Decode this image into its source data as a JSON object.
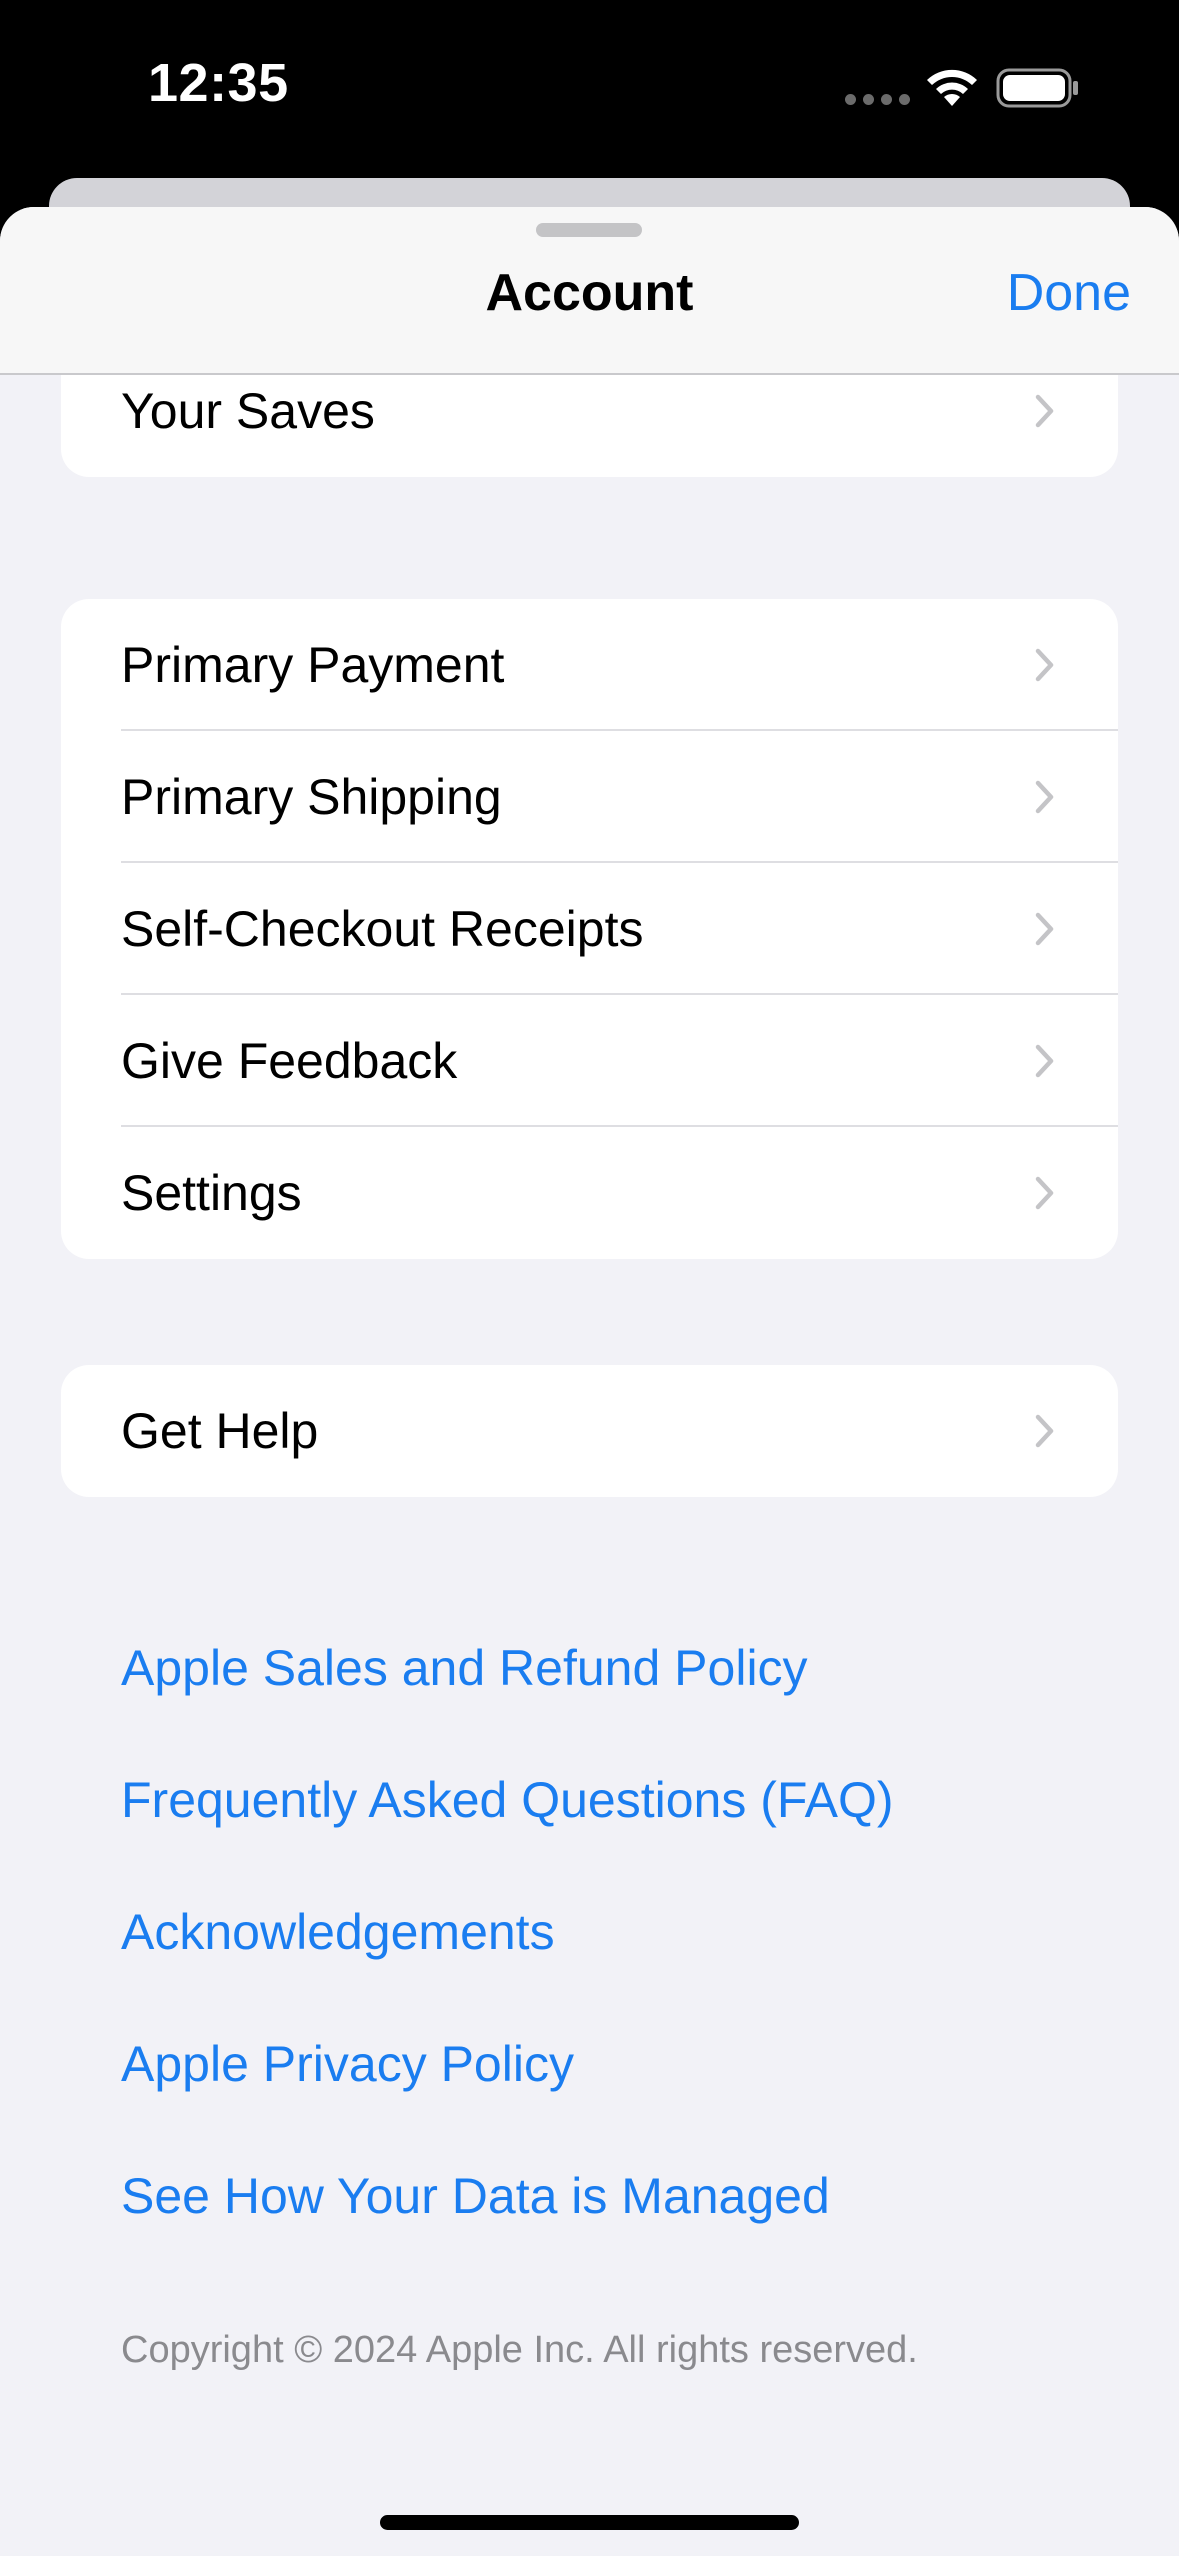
{
  "status_bar": {
    "time": "12:35"
  },
  "nav": {
    "title": "Account",
    "done_label": "Done"
  },
  "groups": {
    "top": [
      {
        "label": "Your Saves"
      }
    ],
    "middle": [
      {
        "label": "Primary Payment"
      },
      {
        "label": "Primary Shipping"
      },
      {
        "label": "Self-Checkout Receipts"
      },
      {
        "label": "Give Feedback"
      },
      {
        "label": "Settings"
      }
    ],
    "help": [
      {
        "label": "Get Help"
      }
    ]
  },
  "links": [
    "Apple Sales and Refund Policy",
    "Frequently Asked Questions (FAQ)",
    "Acknowledgements",
    "Apple Privacy Policy",
    "See How Your Data is Managed"
  ],
  "footer": {
    "copyright": "Copyright © 2024 Apple Inc. All rights reserved."
  },
  "colors": {
    "accent": "#1a7df0",
    "background": "#f2f2f7"
  }
}
